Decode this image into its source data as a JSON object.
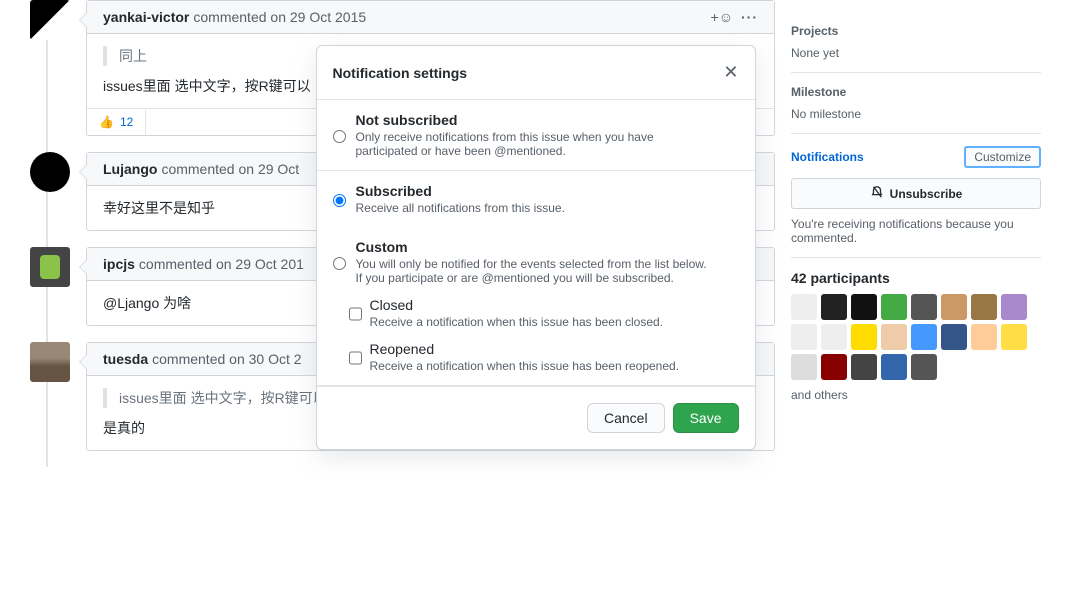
{
  "comments": [
    {
      "author": "yankai-victor",
      "verb": "commented",
      "date": "on 29 Oct 2015",
      "quote": "同上",
      "body": "issues里面 选中文字，按R键可以",
      "reaction_count": "12",
      "show_actions": true,
      "show_reactions": true,
      "show_quote": true
    },
    {
      "author": "Lujango",
      "verb": "commented",
      "date": "on 29 Oct",
      "body": "幸好这里不是知乎"
    },
    {
      "author": "ipcjs",
      "verb": "commented",
      "date": "on 29 Oct 201",
      "body": "@Ljango 为啥"
    },
    {
      "author": "tuesda",
      "verb": "commented",
      "date": "on 30 Oct 2",
      "quote": "issues里面 选中文字，按R键可以快速引用",
      "body": "是真的",
      "show_quote": true
    }
  ],
  "sidebar": {
    "projects": {
      "title": "Projects",
      "value": "None yet"
    },
    "milestone": {
      "title": "Milestone",
      "value": "No milestone"
    },
    "notifications": {
      "title": "Notifications",
      "customize": "Customize",
      "unsubscribe": "Unsubscribe",
      "help": "You're receiving notifications because you commented."
    },
    "participants": {
      "title_prefix": "42 participants",
      "others": "and others"
    }
  },
  "modal": {
    "title": "Notification settings",
    "options": {
      "not_subscribed": {
        "label": "Not subscribed",
        "desc": "Only receive notifications from this issue when you have participated or have been @mentioned."
      },
      "subscribed": {
        "label": "Subscribed",
        "desc": "Receive all notifications from this issue."
      },
      "custom": {
        "label": "Custom",
        "desc": "You will only be notified for the events selected from the list below. If you participate or are @mentioned you will be subscribed.",
        "closed": {
          "label": "Closed",
          "desc": "Receive a notification when this issue has been closed."
        },
        "reopened": {
          "label": "Reopened",
          "desc": "Receive a notification when this issue has been reopened."
        }
      }
    },
    "cancel": "Cancel",
    "save": "Save"
  }
}
